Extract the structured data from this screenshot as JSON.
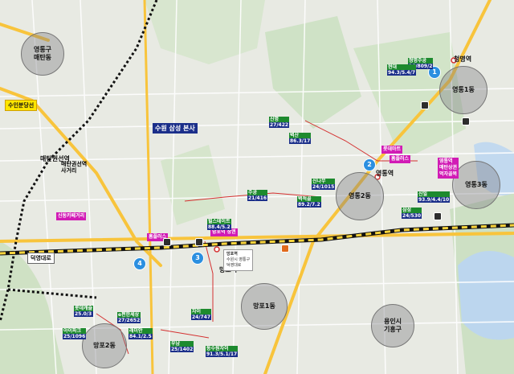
{
  "map": {
    "areas": [
      {
        "id": "yeongtong-gu-maetan",
        "text": "영통구\n매탄동"
      },
      {
        "id": "yeongtong-1",
        "text": "영통1동"
      },
      {
        "id": "yeongtong-2",
        "text": "영통2동"
      },
      {
        "id": "yeongtong-3",
        "text": "영통3동"
      },
      {
        "id": "mangpo-1",
        "text": "망포1동"
      },
      {
        "id": "mangpo-2",
        "text": "망포2동"
      },
      {
        "id": "yongin-giheung",
        "text": "용인시\n기흥구"
      }
    ],
    "stations": [
      {
        "id": "cheongmyeong",
        "text": "청명역"
      },
      {
        "id": "yeongtong",
        "text": "영통역"
      },
      {
        "id": "mangpo",
        "text": "망포역"
      },
      {
        "id": "maetan-gwonseon",
        "text": "매탄권선역"
      }
    ],
    "badges": [
      "1",
      "2",
      "3",
      "4"
    ],
    "tags": {
      "suin_bundang": "수인분당선",
      "deogyeong": "덕영대로",
      "samsung": "수원 삼성 본사",
      "maetan_intersection": "매탄권선역\n사거리",
      "sinlim_cafe": "신동카페거리",
      "homeplus": "홈플러스",
      "mangpo_shopping": "망포역 상권",
      "yeongtong_mart": "롯데마트",
      "yeongtong_plus": "홈플러스",
      "samsung3_market": "영통역\n매탄상권\n먹자골목",
      "mangpo_yeok_right": "망포역"
    },
    "apartments": [
      {
        "id": "a1",
        "lines": [
          "청명주공",
          "26/809/2"
        ],
        "cls": [
          "g",
          "b"
        ]
      },
      {
        "id": "a2",
        "lines": [
          "현대",
          "94.3/5.4/7"
        ],
        "cls": [
          "g",
          "b"
        ]
      },
      {
        "id": "a3",
        "lines": [
          "신명",
          "27/422"
        ],
        "cls": [
          "g",
          "b"
        ]
      },
      {
        "id": "a4",
        "lines": [
          "벽산",
          "86.3/17"
        ],
        "cls": [
          "g",
          "b"
        ]
      },
      {
        "id": "a5",
        "lines": [
          "신나무",
          "24/1015"
        ],
        "cls": [
          "g",
          "b"
        ]
      },
      {
        "id": "a6",
        "lines": [
          "벽적골",
          "89.2/7.2"
        ],
        "cls": [
          "g",
          "b"
        ]
      },
      {
        "id": "a7",
        "lines": [
          "주공",
          "21/416"
        ],
        "cls": [
          "g",
          "b"
        ]
      },
      {
        "id": "a8",
        "lines": [
          "신일",
          "93.9/4.4/10"
        ],
        "cls": [
          "g",
          "b"
        ]
      },
      {
        "id": "a9",
        "lines": [
          "삼성",
          "24/530"
        ],
        "cls": [
          "g",
          "b"
        ]
      },
      {
        "id": "a10",
        "lines": [
          "힐스테이트",
          "88.4/5.2"
        ],
        "cls": [
          "g",
          "b"
        ]
      },
      {
        "id": "a11",
        "lines": [
          "롯데캐슬",
          "25.0/3"
        ],
        "cls": [
          "g",
          "b"
        ]
      },
      {
        "id": "a12",
        "lines": [
          "e편한세상",
          "27/2652"
        ],
        "cls": [
          "g",
          "b"
        ]
      },
      {
        "id": "a13",
        "lines": [
          "래미안",
          "84.1/2.5"
        ],
        "cls": [
          "g",
          "b"
        ]
      },
      {
        "id": "a14",
        "lines": [
          "자이",
          "24/747"
        ],
        "cls": [
          "g",
          "b"
        ]
      },
      {
        "id": "a15",
        "lines": [
          "아이파크",
          "25/1096"
        ],
        "cls": [
          "g",
          "b"
        ]
      },
      {
        "id": "a16",
        "lines": [
          "동수원자이",
          "91.3/5.1/17"
        ],
        "cls": [
          "g",
          "b"
        ]
      },
      {
        "id": "a17",
        "lines": [
          "우남",
          "25/1402"
        ],
        "cls": [
          "g",
          "b"
        ]
      }
    ],
    "popup": {
      "line1": "망포역",
      "line2": "수원시 영통구",
      "line3": "덕영대로"
    }
  }
}
